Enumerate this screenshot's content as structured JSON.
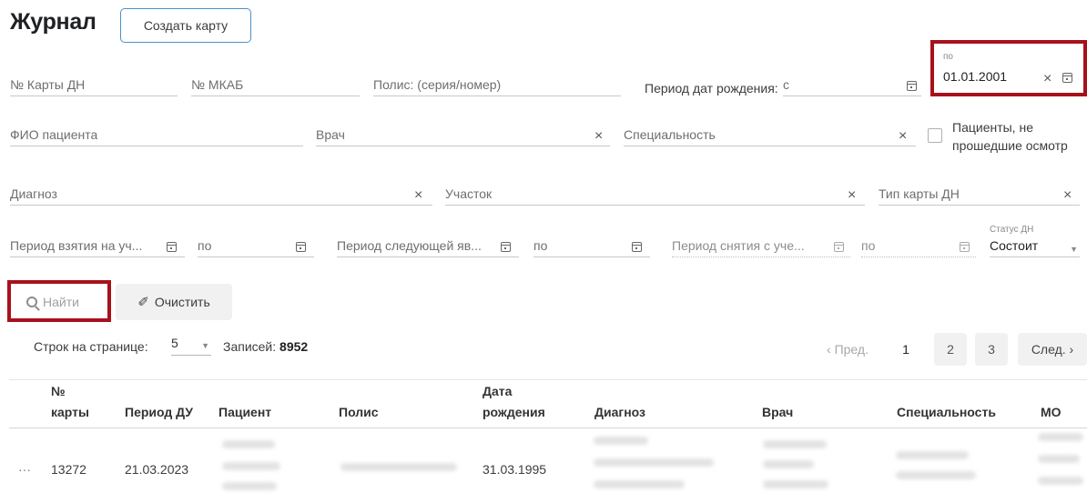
{
  "header": {
    "title": "Журнал",
    "create_button": "Создать карту"
  },
  "filters": {
    "card_dn": "№ Карты ДН",
    "mkab": "№ МКАБ",
    "policy": "Полис: (серия/номер)",
    "birth_period_label": "Период дат рождения:",
    "birth_from": "с",
    "birth_to_label": "по",
    "birth_to_value": "01.01.2001",
    "patient_name": "ФИО пациента",
    "doctor": "Врач",
    "specialty": "Специальность",
    "not_examined_line1": "Пациенты, не",
    "not_examined_line2": "прошедшие осмотр",
    "diagnosis": "Диагноз",
    "district": "Участок",
    "card_type": "Тип карты ДН",
    "registration_period": "Период взятия на уч...",
    "registration_to": "по",
    "next_visit_period": "Период следующей яв...",
    "next_visit_to": "по",
    "deregistration_period": "Период снятия с уче...",
    "deregistration_to": "по",
    "status_label": "Статус ДН",
    "status_value": "Состоит"
  },
  "actions": {
    "find": "Найти",
    "clear": "Очистить"
  },
  "pagination": {
    "rows_label": "Строк на странице:",
    "rows_value": "5",
    "records_label": "Записей:",
    "records_count": "8952",
    "prev": "‹ Пред.",
    "pages": [
      "1",
      "2",
      "3"
    ],
    "next": "След. ›"
  },
  "table": {
    "headers": {
      "card_no_1": "№",
      "card_no_2": "карты",
      "period": "Период ДУ",
      "patient": "Пациент",
      "policy": "Полис",
      "birth_1": "Дата",
      "birth_2": "рождения",
      "diagnosis": "Диагноз",
      "doctor": "Врач",
      "specialty": "Специальность",
      "mo": "МО"
    },
    "rows": [
      {
        "menu": "···",
        "card_no": "13272",
        "period": "21.03.2023",
        "birth_date": "31.03.1995"
      }
    ]
  },
  "colors": {
    "highlight": "#a8111b",
    "accent": "#4a90c8"
  }
}
